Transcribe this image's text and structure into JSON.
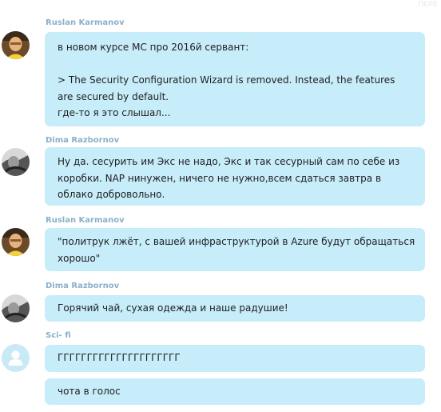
{
  "corner_label": "ПЕРЕ",
  "messages": [
    {
      "sender": "Ruslan Karmanov",
      "avatar": "user-photo",
      "lines": [
        "в новом курсе МС про 2016й сервант:",
        "",
        "> The Security Configuration Wizard is removed. Instead, the features",
        "are secured by default.",
        "где-то я это слышал..."
      ]
    },
    {
      "sender": "Dima Razbornov",
      "avatar": "user-photo-bw",
      "lines": [
        "Ну да. сесурить им Экс не надо, Экс и так сесурный сам по себе из",
        "коробки. NAP нинужен, ничего не нужно,всем сдаться завтра в",
        "облако добровольно."
      ]
    },
    {
      "sender": "Ruslan Karmanov",
      "avatar": "user-photo",
      "lines": [
        "\"политрук лжёт, с вашей инфраструктурой в Azure будут обращаться",
        "хорошо\""
      ]
    },
    {
      "sender": "Dima Razbornov",
      "avatar": "user-photo-bw",
      "lines": [
        "Горячий чай, сухая одежда и наше радушие!"
      ]
    },
    {
      "sender": "Sci- fi",
      "avatar": "default-user-icon",
      "lines": [
        "ГГГГГГГГГГГГГГГГГГГГГ"
      ]
    },
    {
      "sender": "",
      "avatar": "",
      "lines": [
        "чота в голос"
      ]
    }
  ]
}
